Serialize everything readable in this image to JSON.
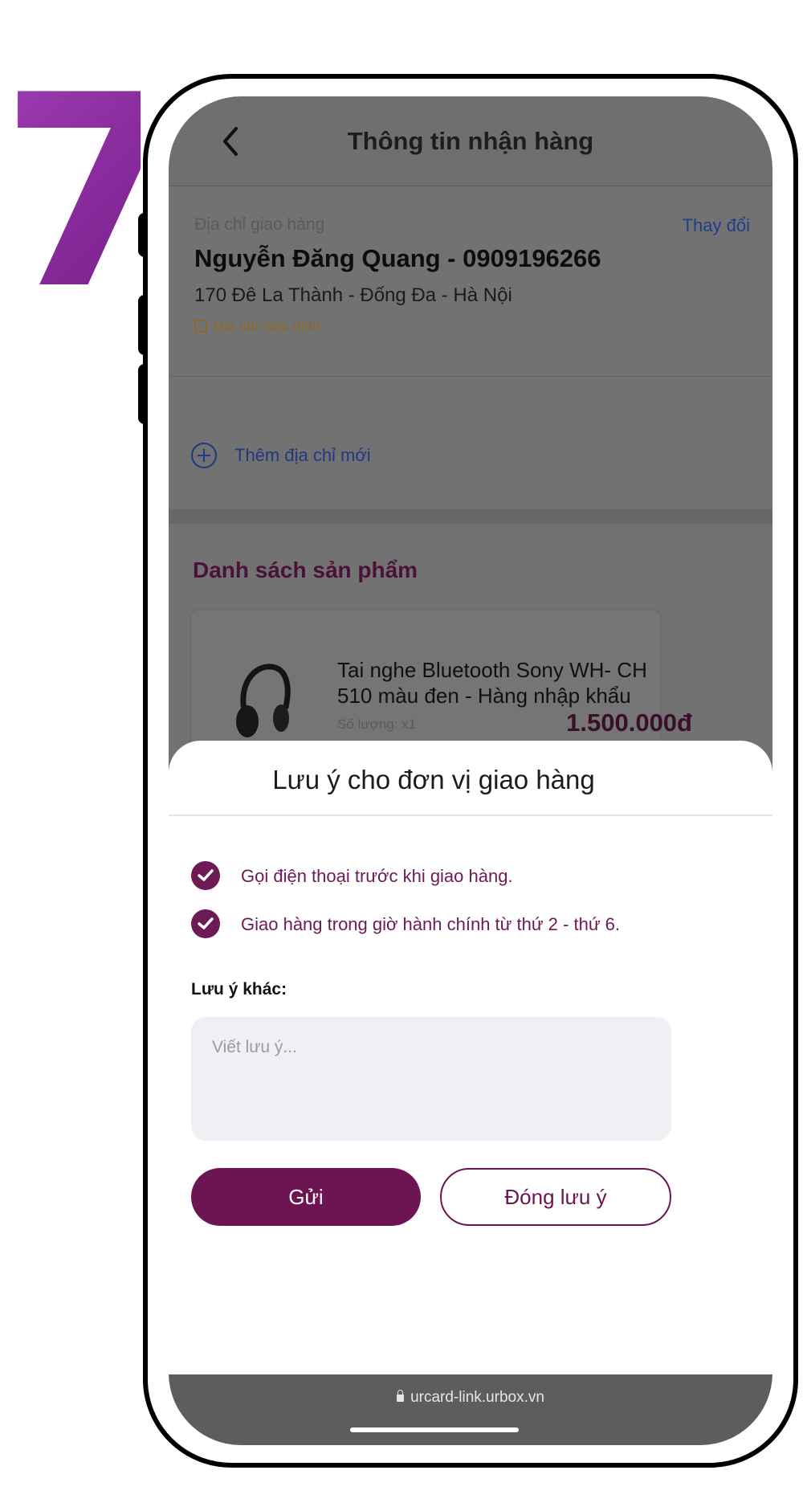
{
  "step": {
    "number": "7",
    "color": "#8a2aa0"
  },
  "header": {
    "title": "Thông tin nhận hàng",
    "back_icon": "chevron-left-icon"
  },
  "address": {
    "label": "Địa chỉ giao hàng",
    "change_link": "Thay đổi",
    "recipient": "Nguyễn Đăng Quang - 0909196266",
    "street": "170 Đê La Thành - Đống Đa - Hà Nội",
    "default_tag": "Địa chỉ mặc định"
  },
  "add_address": {
    "label": "Thêm địa chỉ mới"
  },
  "products": {
    "title": "Danh sách sản phẩm",
    "items": [
      {
        "name": "Tai nghe Bluetooth Sony WH- CH 510 màu đen - Hàng nhập khẩu",
        "quantity": "Số lượng: x1",
        "price": "1.500.000đ"
      }
    ]
  },
  "sheet": {
    "title": "Lưu ý cho đơn vị giao hàng",
    "options": [
      {
        "label": "Gọi điện thoại trước khi giao hàng.",
        "checked": true
      },
      {
        "label": "Giao hàng trong giờ hành chính từ thứ 2 - thứ 6.",
        "checked": true
      }
    ],
    "other_label": "Lưu ý khác:",
    "note_placeholder": "Viết lưu ý...",
    "send_button": "Gửi",
    "close_button": "Đóng lưu ý",
    "accent_color": "#6d1453"
  },
  "browser": {
    "url": "urcard-link.urbox.vn"
  }
}
